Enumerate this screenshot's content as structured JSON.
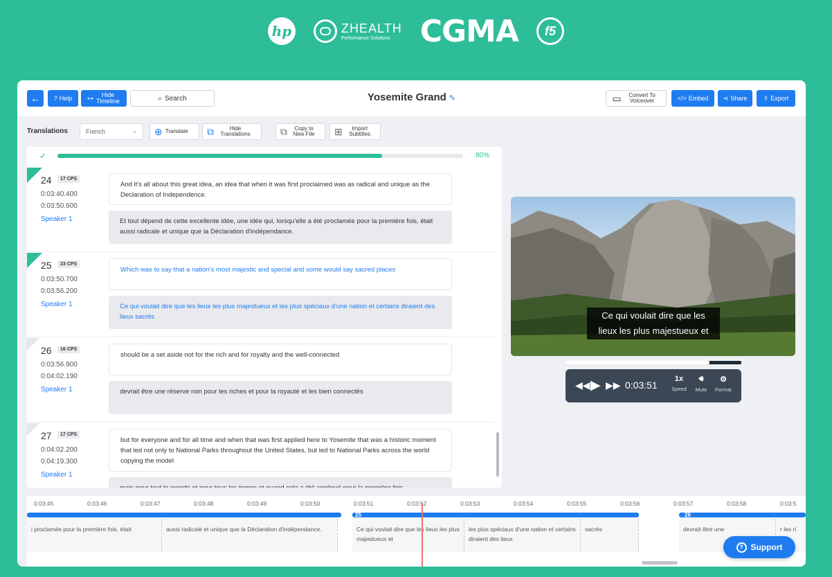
{
  "logos": {
    "hp": "hp",
    "zhealth": "ZHEALTH",
    "zhealth_sub": "Performance Solutions",
    "cgma": "CGMA",
    "f5": "f5"
  },
  "topbar": {
    "help_label": "Help",
    "hide_timeline_label": "Hide Timeline",
    "search_label": "Search",
    "title": "Yosemite Grand",
    "convert_label": "Convert To Voiceover",
    "embed_label": "Embed",
    "share_label": "Share",
    "export_label": "Export"
  },
  "toolbar": {
    "translations_label": "Translations",
    "language": "French",
    "translate_label": "Translate",
    "hide_translations_label": "Hide Translations",
    "copy_label": "Copy to New File",
    "import_label": "Import Subtitles"
  },
  "progress": {
    "percent_label": "80%",
    "value": 0.8
  },
  "segments": [
    {
      "num": "24",
      "cps": "17 CPS",
      "start": "0:03:40.400",
      "end": "0:03:50.600",
      "speaker": "Speaker 1",
      "checked": true,
      "source": "And it's all about this great idea, an idea that when it was first proclaimed was as radical and unique as the Declaration of Independence.",
      "translation": "Et tout dépend de cette excellente idée, une idée qui, lorsqu'elle a été proclamée pour la première fois, était aussi radicale et unique que la Déclaration d'indépendance."
    },
    {
      "num": "25",
      "cps": "23 CPS",
      "start": "0:03:50.700",
      "end": "0:03:56.200",
      "speaker": "Speaker 1",
      "checked": true,
      "source": "Which was to say that a nation's most majestic and special and some would say sacred places",
      "translation": "Ce qui voulait dire que les lieux les plus majestueux et les plus spéciaux d'une nation et certains diraient des lieux sacrés"
    },
    {
      "num": "26",
      "cps": "16 CPS",
      "start": "0:03:56.900",
      "end": "0:04:02.190",
      "speaker": "Speaker 1",
      "checked": false,
      "source": "should be a set aside not for the rich and for royalty and the well-connected",
      "translation": "devrait être une réserve non pour les riches et pour la royauté et les bien connectés"
    },
    {
      "num": "27",
      "cps": "17 CPS",
      "start": "0:04:02.200",
      "end": "0:04:19.300",
      "speaker": "Speaker 1",
      "checked": false,
      "source": "but for everyone and for all time and when that was first applied here to Yosemite that was a historic moment that led not only to National Parks throughout the United States, but led to National Parks across the world copying the model",
      "translation": "mais pour tout le monde et pour tous les temps et quand cela a été appliqué pour la première fois"
    }
  ],
  "video": {
    "caption_line1": "Ce qui voulait dire que les",
    "caption_line2": "lieux les plus majestueux et",
    "time": "0:03:51",
    "played": 0.82,
    "speed_value": "1x",
    "speed_label": "Speed",
    "mute_label": "Mute",
    "format_label": "Format"
  },
  "timeline": {
    "ticks": [
      "0:03:45",
      "0:03:46",
      "0:03:47",
      "0:03:48",
      "0:03:49",
      "0:03:50",
      "0:03:51",
      "0:03:52",
      "0:03:53",
      "0:03:54",
      "0:03:55",
      "0:03:56",
      "0:03:57",
      "0:03:58",
      "0:03:5"
    ],
    "seg25_num": "25",
    "seg26_num": "26",
    "blocks": [
      "i proclamée pour la première fois, était",
      "aussi radicale et unique que la Déclaration d'indépendance.",
      "Ce qui voulait dire que les lieux les plus majestueux et",
      "les plus spéciaux d'une nation et certains diraient des lieux",
      "sacrés",
      "devrait être une",
      "r les ri"
    ]
  },
  "support_label": "Support",
  "colors": {
    "accent": "#1f7cf0",
    "brand_green": "#2dbd98"
  }
}
